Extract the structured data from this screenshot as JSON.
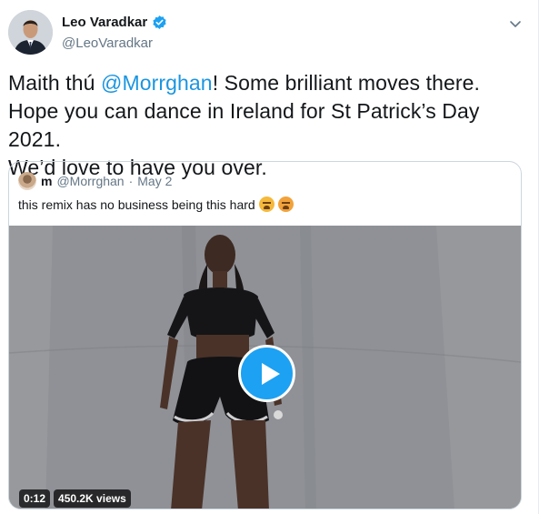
{
  "author": {
    "name": "Leo Varadkar",
    "handle": "@LeoVaradkar",
    "verified": true
  },
  "tweet": {
    "line1_before": "Maith thú ",
    "line1_mention": "@Morrghan",
    "line1_after": "! Some brilliant moves there.",
    "line2": "Hope you can dance in Ireland for St Patrick’s Day 2021.",
    "line3": "We’d love to have you over."
  },
  "quoted": {
    "name": "m",
    "handle": "@Morrghan",
    "separator": "·",
    "date": "May 2",
    "text": "this remix has no business being this hard",
    "emojis": [
      "weary-face-emoji",
      "face-with-steam-emoji"
    ],
    "video": {
      "duration": "0:12",
      "views": "450.2K views"
    }
  },
  "colors": {
    "link": "#1b95e0",
    "play_button": "#1da1f2",
    "secondary_text": "#657786",
    "primary_text": "#14171a"
  }
}
